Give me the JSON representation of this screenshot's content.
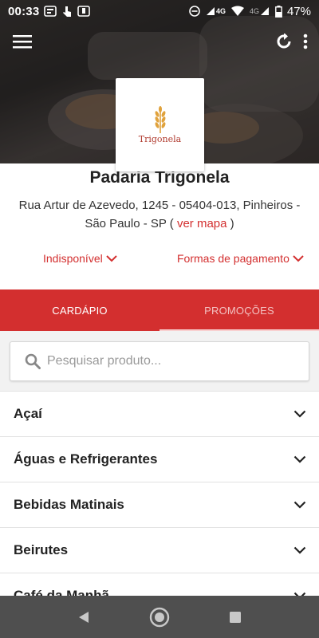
{
  "status_bar": {
    "time": "00:33",
    "network": "4G",
    "network2": "4G",
    "battery": "47%"
  },
  "store": {
    "name": "Padaria Trigonela",
    "address": "Rua Artur de Azevedo, 1245 - 05404-013, Pinheiros - São Paulo - SP (",
    "map_link": "ver mapa",
    "address_end": ")",
    "logo_text": "Trigonela"
  },
  "dropdowns": {
    "availability": "Indisponível",
    "payment": "Formas de pagamento"
  },
  "tabs": [
    {
      "label": "CARDÁPIO",
      "active": true
    },
    {
      "label": "PROMOÇÕES",
      "active": false
    }
  ],
  "search": {
    "placeholder": "Pesquisar produto...",
    "value": ""
  },
  "categories": [
    {
      "label": "Açaí"
    },
    {
      "label": "Águas e Refrigerantes"
    },
    {
      "label": "Bebidas Matinais"
    },
    {
      "label": "Beirutes"
    },
    {
      "label": "Café da Manhã"
    }
  ],
  "colors": {
    "accent": "#d32f2f",
    "nav_bar": "#4f4f4f"
  },
  "icons": [
    "menu-icon",
    "refresh-icon",
    "more-vert-icon",
    "search-icon",
    "chevron-down-icon",
    "back-icon",
    "home-icon",
    "recents-icon"
  ]
}
